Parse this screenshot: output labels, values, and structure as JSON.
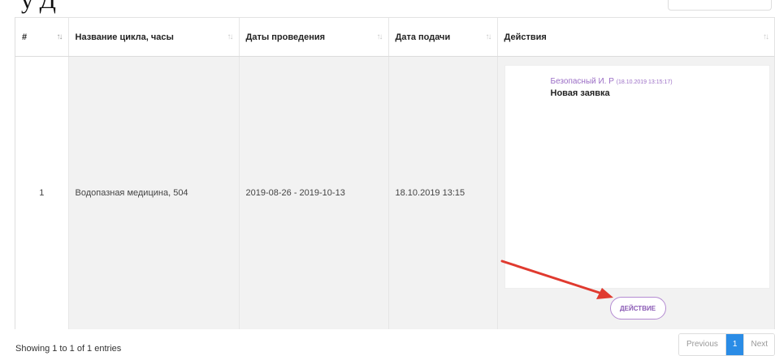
{
  "header_fragment": "у Д",
  "table": {
    "columns": [
      {
        "label": "#",
        "sort_icon": "sort-arrows"
      },
      {
        "label": "Название цикла, часы",
        "sort_icon": "sort-arrows"
      },
      {
        "label": "Даты проведения",
        "sort_icon": "sort-arrows"
      },
      {
        "label": "Дата подачи",
        "sort_icon": "sort-arrows"
      },
      {
        "label": "Действия",
        "sort_icon": "sort-arrows"
      }
    ],
    "rows": [
      {
        "num": "1",
        "cycle": "Водопазная медицина, 504",
        "dates": "2019-08-26 - 2019-10-13",
        "submitted": "18.10.2019 13:15",
        "action_card": {
          "author": "Безопасный И. Р",
          "timestamp": "(18.10.2019 13:15:17)",
          "status": "Новая заявка"
        },
        "action_button": "ДЕЙСТВИЕ"
      }
    ]
  },
  "footer": {
    "info": "Showing 1 to 1 of 1 entries",
    "pagination": {
      "previous": "Previous",
      "current_page": "1",
      "next": "Next"
    }
  },
  "colors": {
    "accent_purple": "#9b6ec6",
    "pager_active": "#2a8ce6",
    "annotation_arrow": "#e03a2f"
  }
}
